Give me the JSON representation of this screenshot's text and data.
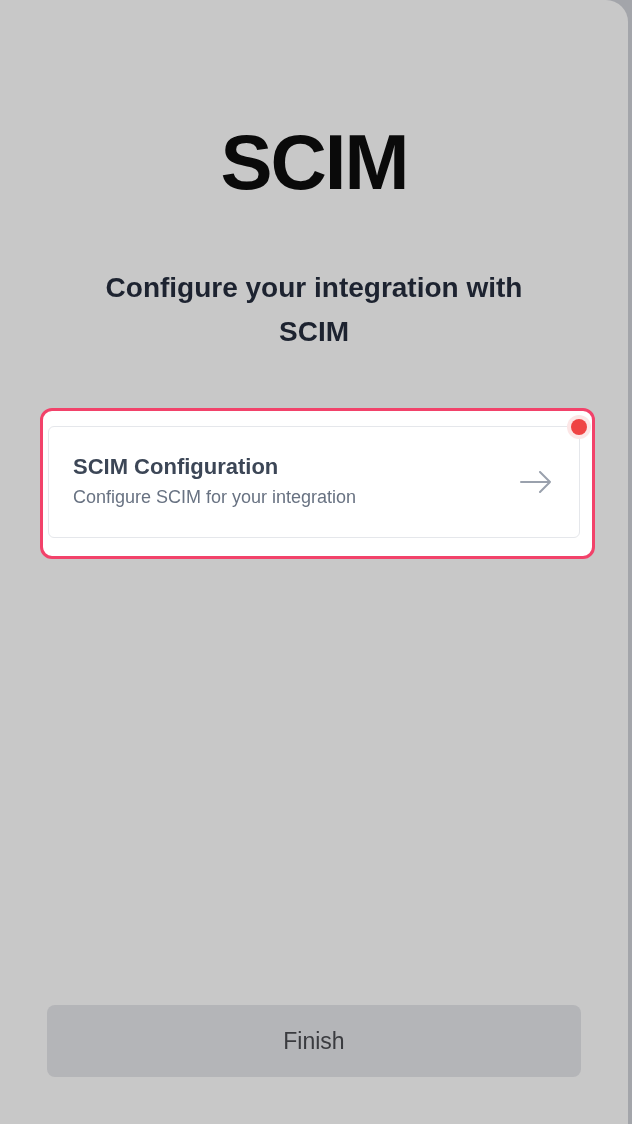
{
  "logo": {
    "text": "SCIM"
  },
  "heading": "Configure your integration with SCIM",
  "cards": [
    {
      "title": "SCIM Configuration",
      "description": "Configure SCIM for your integration",
      "highlighted": true
    }
  ],
  "finish_button": {
    "label": "Finish"
  }
}
